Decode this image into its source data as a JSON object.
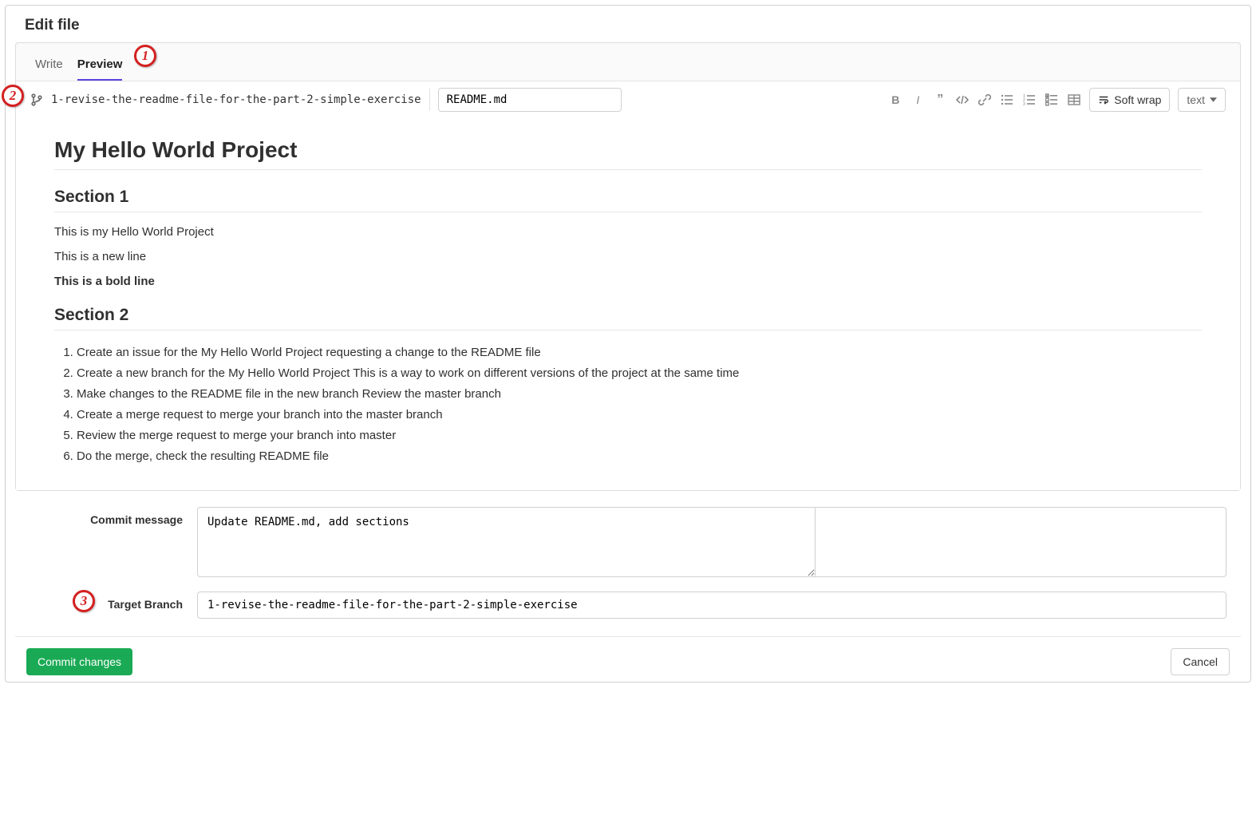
{
  "page": {
    "title": "Edit file"
  },
  "tabs": {
    "write": "Write",
    "preview": "Preview"
  },
  "editor": {
    "branch_name": "1-revise-the-readme-file-for-the-part-2-simple-exercise",
    "filename": "README.md",
    "softwrap_label": "Soft wrap",
    "syntax_label": "text"
  },
  "preview": {
    "h1": "My Hello World Project",
    "section1_heading": "Section 1",
    "section1_p1": "This is my Hello World Project",
    "section1_p2": "This is a new line",
    "section1_p3_bold": "This is a bold line",
    "section2_heading": "Section 2",
    "section2_list": [
      "Create an issue for the My Hello World Project requesting a change to the README file",
      "Create a new branch for the My Hello World Project This is a way to work on different versions of the project at the same time",
      "Make changes to the README file in the new branch Review the master branch",
      "Create a merge request to merge your branch into the master branch",
      "Review the merge request to merge your branch into master",
      "Do the merge, check the resulting README file"
    ]
  },
  "commit": {
    "message_label": "Commit message",
    "message_value": "Update README.md, add sections",
    "target_label": "Target Branch",
    "target_value": "1-revise-the-readme-file-for-the-part-2-simple-exercise"
  },
  "footer": {
    "commit_button": "Commit changes",
    "cancel_button": "Cancel"
  },
  "annotations": {
    "n1": "1",
    "n2": "2",
    "n3": "3"
  }
}
